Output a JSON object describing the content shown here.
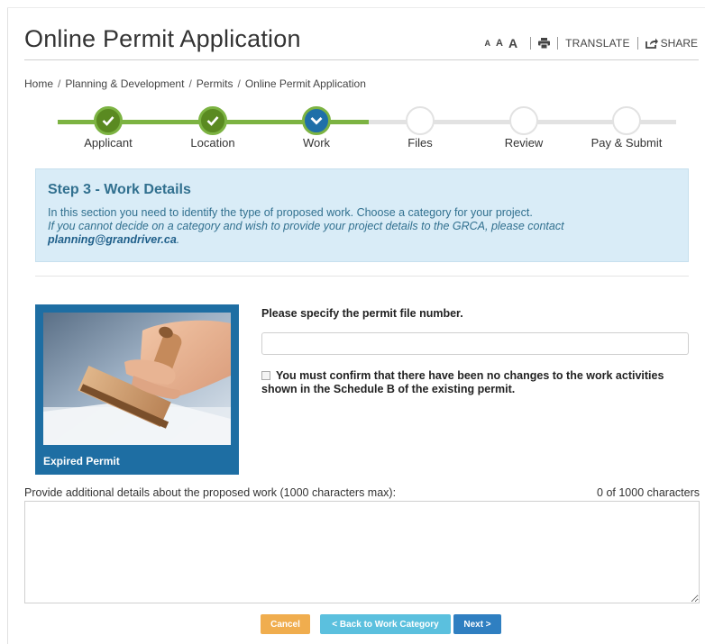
{
  "header": {
    "title": "Online Permit Application",
    "font_small": "A",
    "font_medium": "A",
    "font_large": "A",
    "print_icon": "print-icon",
    "translate_label": "TRANSLATE",
    "share_icon": "share-icon",
    "share_label": "SHARE"
  },
  "breadcrumb": [
    "Home",
    "Planning & Development",
    "Permits",
    "Online Permit Application"
  ],
  "breadcrumb_divider": "/",
  "steps": [
    {
      "label": "Applicant",
      "state": "complete"
    },
    {
      "label": "Location",
      "state": "complete"
    },
    {
      "label": "Work",
      "state": "current"
    },
    {
      "label": "Files",
      "state": "incomplete"
    },
    {
      "label": "Review",
      "state": "incomplete"
    },
    {
      "label": "Pay & Submit",
      "state": "incomplete"
    }
  ],
  "info": {
    "heading": "Step 3 - Work Details",
    "text": "In this section you need to identify the type of proposed work. Choose a category for your project.",
    "contact_text": "If you cannot decide on a category and wish to provide your project details to the GRCA, please contact",
    "email": "planning@grandriver.ca",
    "email_suffix": "."
  },
  "category": {
    "caption": "Expired Permit"
  },
  "form": {
    "permit_label": "Please specify the permit file number.",
    "permit_value": "",
    "confirm_text": "You must confirm that there have been no changes to the work activities shown in the Schedule B of the existing permit.",
    "confirm_checked": false,
    "details_label": "Provide additional details about the proposed work (1000 characters max):",
    "char_count": "0 of 1000 characters",
    "details_value": ""
  },
  "buttons": {
    "cancel": "Cancel",
    "back": "< Back to Work Category",
    "next": "Next >"
  },
  "colors": {
    "progress_done": "#7cb342",
    "step_current": "#1f6fa8",
    "info_bg": "#d9ecf7",
    "cancel": "#f0ad4e",
    "back": "#5bc0de",
    "next": "#2f7fc1"
  }
}
